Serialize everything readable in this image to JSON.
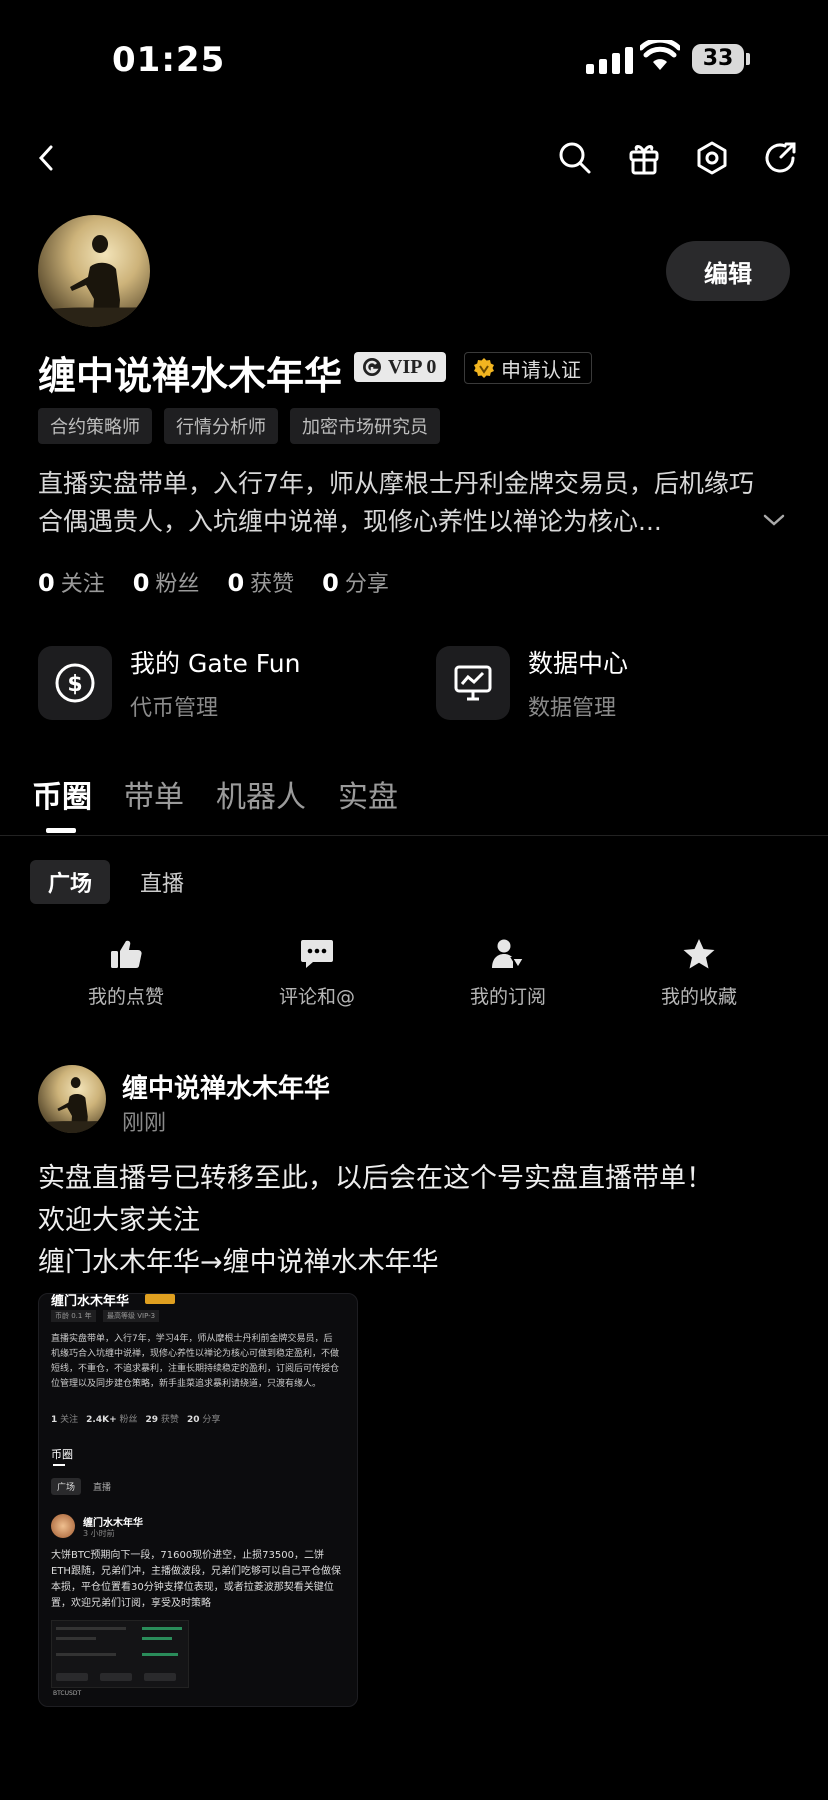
{
  "status_bar": {
    "time": "01:25",
    "battery": "33"
  },
  "profile": {
    "username": "缠中说禅水木年华",
    "vip_label": "VIP 0",
    "verify_label": "申请认证",
    "edit_label": "编辑",
    "tags": [
      "合约策略师",
      "行情分析师",
      "加密市场研究员"
    ],
    "bio": "直播实盘带单，入行7年，师从摩根士丹利金牌交易员，后机缘巧合偶遇贵人，入坑缠中说禅，现修心养性以禅论为核心...",
    "stats": [
      {
        "value": "0",
        "label": "关注"
      },
      {
        "value": "0",
        "label": "粉丝"
      },
      {
        "value": "0",
        "label": "获赞"
      },
      {
        "value": "0",
        "label": "分享"
      }
    ]
  },
  "services": [
    {
      "title": "我的 Gate Fun",
      "subtitle": "代币管理",
      "icon": "dollar-circle-icon"
    },
    {
      "title": "数据中心",
      "subtitle": "数据管理",
      "icon": "chart-monitor-icon"
    }
  ],
  "tabs": [
    "币圈",
    "带单",
    "机器人",
    "实盘"
  ],
  "subtabs": [
    "广场",
    "直播"
  ],
  "actions": [
    {
      "label": "我的点赞",
      "icon": "thumbs-up-icon"
    },
    {
      "label": "评论和@",
      "icon": "comment-icon"
    },
    {
      "label": "我的订阅",
      "icon": "subscribe-user-icon"
    },
    {
      "label": "我的收藏",
      "icon": "star-icon"
    }
  ],
  "post": {
    "author": "缠中说禅水木年华",
    "time": "刚刚",
    "lines": [
      "实盘直播号已转移至此，以后会在这个号实盘直播带单！",
      "欢迎大家关注",
      "缠门水木年华→缠中说禅水木年华"
    ],
    "embed": {
      "header_name": "缠门水木年华",
      "tags": [
        "币龄 0.1 年",
        "最高等级 VIP-3"
      ],
      "bio": "直播实盘带单，入行7年，学习4年，师从摩根士丹利前金牌交易员，后机缘巧合入坑缠中说禅，现修心养性以禅论为核心可做到稳定盈利，不做短线，不重仓，不追求暴利，注重长期持续稳定的盈利，订阅后可传授仓位管理以及同步建仓策略，新手韭菜追求暴利请绕道，只渡有缘人。",
      "stats": [
        {
          "value": "1",
          "label": "关注"
        },
        {
          "value": "2.4K+",
          "label": "粉丝"
        },
        {
          "value": "29",
          "label": "获赞"
        },
        {
          "value": "20",
          "label": "分享"
        }
      ],
      "tab": "币圈",
      "subtabs": [
        "广场",
        "直播"
      ],
      "post_author": "缠门水木年华",
      "post_time": "3 小时前",
      "post_text": "大饼BTC预期向下一段，71600现价进空，止损73500，二饼ETH跟随，兄弟们冲，主播做波段，兄弟们吃够可以自己平仓做保本损，平仓位置看30分钟支撑位表现，或者拉菱波那契看关键位置，欢迎兄弟们订阅，享受及时策略",
      "ticker": "BTCUSDT"
    }
  }
}
